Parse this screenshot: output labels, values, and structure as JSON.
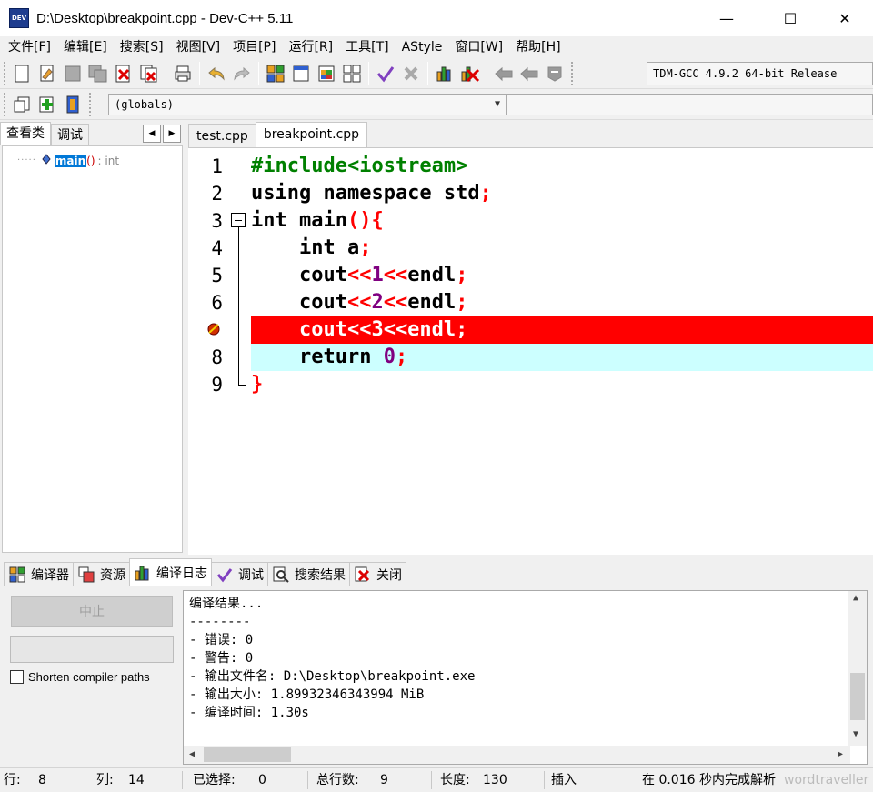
{
  "window": {
    "icon_text": "DEV",
    "title": "D:\\Desktop\\breakpoint.cpp - Dev-C++ 5.11",
    "minimize": "—",
    "maximize": "☐",
    "close": "✕"
  },
  "menu": [
    "文件[F]",
    "编辑[E]",
    "搜索[S]",
    "视图[V]",
    "项目[P]",
    "运行[R]",
    "工具[T]",
    "AStyle",
    "窗口[W]",
    "帮助[H]"
  ],
  "toolbar": {
    "compiler": "TDM-GCC 4.9.2 64-bit Release",
    "scope": "(globals)"
  },
  "left_panel": {
    "tabs": [
      "查看类",
      "调试"
    ],
    "nav_prev": "◀",
    "nav_next": "▶",
    "tree": {
      "name": "main",
      "paren": "()",
      "type": ": int"
    }
  },
  "editor": {
    "tabs": [
      "test.cpp",
      "breakpoint.cpp"
    ],
    "line_numbers": [
      "1",
      "2",
      "3",
      "4",
      "5",
      "6",
      "",
      "8",
      "9"
    ],
    "lines": [
      [
        {
          "t": "#include<iostream>",
          "c": "pp"
        }
      ],
      [
        {
          "t": "using namespace std",
          "c": "k"
        },
        {
          "t": ";",
          "c": "sym"
        }
      ],
      [
        {
          "t": "int main",
          "c": "k"
        },
        {
          "t": "(){",
          "c": "sym"
        }
      ],
      [
        {
          "t": "    int a",
          "c": "k"
        },
        {
          "t": ";",
          "c": "sym"
        }
      ],
      [
        {
          "t": "    cout",
          "c": "k"
        },
        {
          "t": "<<",
          "c": "sym"
        },
        {
          "t": "1",
          "c": "num"
        },
        {
          "t": "<<",
          "c": "sym"
        },
        {
          "t": "endl",
          "c": "k"
        },
        {
          "t": ";",
          "c": "sym"
        }
      ],
      [
        {
          "t": "    cout",
          "c": "k"
        },
        {
          "t": "<<",
          "c": "sym"
        },
        {
          "t": "2",
          "c": "num"
        },
        {
          "t": "<<",
          "c": "sym"
        },
        {
          "t": "endl",
          "c": "k"
        },
        {
          "t": ";",
          "c": "sym"
        }
      ],
      [
        {
          "t": "    cout<<3<<endl;",
          "c": "k"
        }
      ],
      [
        {
          "t": "    return ",
          "c": "k"
        },
        {
          "t": "0",
          "c": "num"
        },
        {
          "t": ";",
          "c": "sym"
        }
      ],
      [
        {
          "t": "}",
          "c": "sym"
        }
      ]
    ],
    "breakpoint_line": 7,
    "current_line": 8
  },
  "bottom_tabs": [
    "编译器",
    "资源",
    "编译日志",
    "调试",
    "搜索结果",
    "关闭"
  ],
  "compile_log": {
    "stop_button": "中止",
    "shorten_label": "Shorten compiler paths",
    "lines": [
      "编译结果...",
      "--------",
      "- 错误: 0",
      "- 警告: 0",
      "- 输出文件名: D:\\Desktop\\breakpoint.exe",
      "- 输出大小: 1.89932346343994 MiB",
      "- 编译时间: 1.30s"
    ]
  },
  "status": {
    "row_label": "行:",
    "row": "8",
    "col_label": "列:",
    "col": "14",
    "sel_label": "已选择:",
    "sel": "0",
    "lines_label": "总行数:",
    "lines": "9",
    "len_label": "长度:",
    "len": "130",
    "mode": "插入",
    "parse": "在 0.016 秒内完成解析",
    "watermark": "wordtraveller"
  }
}
